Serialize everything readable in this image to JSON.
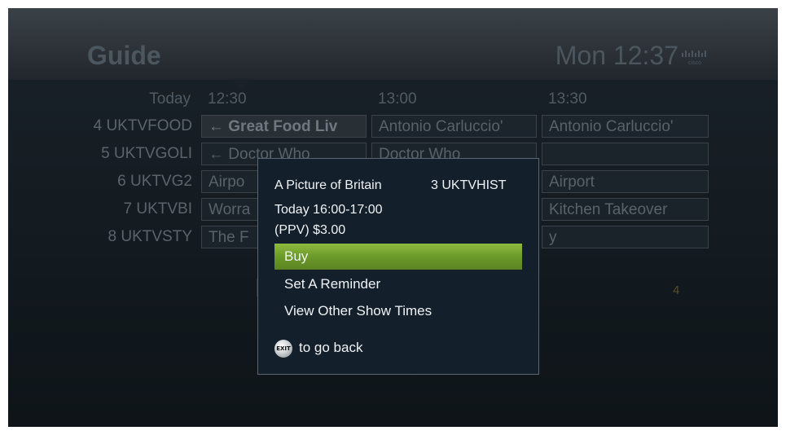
{
  "header": {
    "title": "Guide",
    "clock": "Mon 12:37",
    "logo_icon": "cisco-logo-icon"
  },
  "guide": {
    "day": "Today",
    "times": [
      "12:30",
      "13:00",
      "13:30"
    ],
    "rows": [
      {
        "channel": "4 UKTVFOOD",
        "programs": [
          "← Great Food Liv",
          "Antonio Carluccio'",
          "Antonio Carluccio'"
        ]
      },
      {
        "channel": "5 UKTVGOLI",
        "programs": [
          "← Doctor Who",
          "Doctor Who",
          ""
        ]
      },
      {
        "channel": "6 UKTVG2",
        "programs": [
          "Airpo",
          "",
          "Airport"
        ]
      },
      {
        "channel": "7 UKTVBI",
        "programs": [
          "Worra",
          "",
          "Kitchen Takeover"
        ]
      },
      {
        "channel": "8 UKTVSTY",
        "programs": [
          "The F",
          "",
          "y"
        ]
      }
    ],
    "page_number": "4"
  },
  "popup": {
    "title": "A Picture of Britain",
    "channel": "3 UKTVHIST",
    "time": "Today 16:00-17:00",
    "price": "(PPV) $3.00",
    "menu": [
      "Buy",
      "Set A Reminder",
      "View Other Show Times"
    ],
    "selected_index": 0,
    "exit_label": "EXIT",
    "exit_text": "to go back"
  },
  "colors": {
    "highlight": "#7aa832",
    "popup_bg": "#13202b"
  }
}
